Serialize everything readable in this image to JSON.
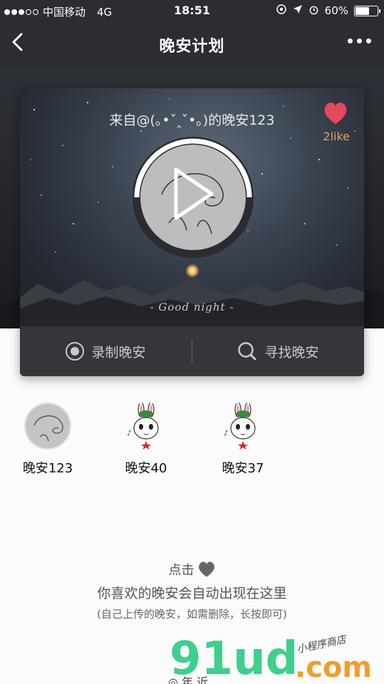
{
  "status": {
    "carrier": "中国移动",
    "network": "4G",
    "time": "18:51",
    "battery": "60%"
  },
  "nav": {
    "title": "晚安计划"
  },
  "card": {
    "from": "来自@(｡•ˇ‸ˇ•｡)的晚安123",
    "like_count": "2like",
    "overlay": "- Good night -",
    "record_label": "录制晚安",
    "find_label": "寻找晚安"
  },
  "list": [
    {
      "name": "晚安123",
      "avatar": "gray-doodle"
    },
    {
      "name": "晚安40",
      "avatar": "rabbit"
    },
    {
      "name": "晚安37",
      "avatar": "rabbit"
    }
  ],
  "hint": {
    "click": "点击",
    "line2": "你喜欢的晚安会自动出现在这里",
    "line3": "(自己上传的晚安，如需删除，长按即可)"
  },
  "watermark": {
    "big": "91ud",
    "com": ".com",
    "small": "小程序商店"
  },
  "bottom_cut": "◎ 年 近",
  "colors": {
    "nav_bg": "#2b2d33",
    "heart": "#e8485b",
    "like": "#e0a06a",
    "watermark_green": "#3fcf8e",
    "watermark_orange": "#f29b2a"
  }
}
